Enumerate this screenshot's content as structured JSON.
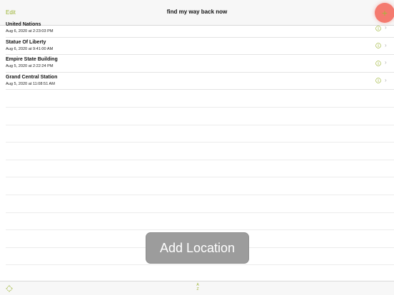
{
  "nav": {
    "edit_label": "Edit",
    "title": "find my way back now",
    "add_label": "+"
  },
  "locations": [
    {
      "name": "United Nations",
      "date": "Aug 6, 2020 at 2:23:03 PM"
    },
    {
      "name": "Statue Of Liberty",
      "date": "Aug 6, 2020 at 9:41:00 AM"
    },
    {
      "name": "Empire State Building",
      "date": "Aug 5, 2020 at 2:22:24 PM"
    },
    {
      "name": "Grand Central Station",
      "date": "Aug 5, 2020 at 11:08:51 AM"
    }
  ],
  "row_icons": {
    "info": "info-icon",
    "disclosure": "chevron-right-icon"
  },
  "toast": {
    "label": "Add Location"
  },
  "toolbar": {
    "left_icon": "location-crosshair-icon",
    "sort_icon": "sort-az-icon",
    "sort_top": "A",
    "sort_bottom": "Z"
  },
  "colors": {
    "accent": "#9cb433",
    "add_button": "#f47a6f",
    "toast_bg": "#9c9c9c",
    "bar_bg": "#f7f7f7"
  }
}
